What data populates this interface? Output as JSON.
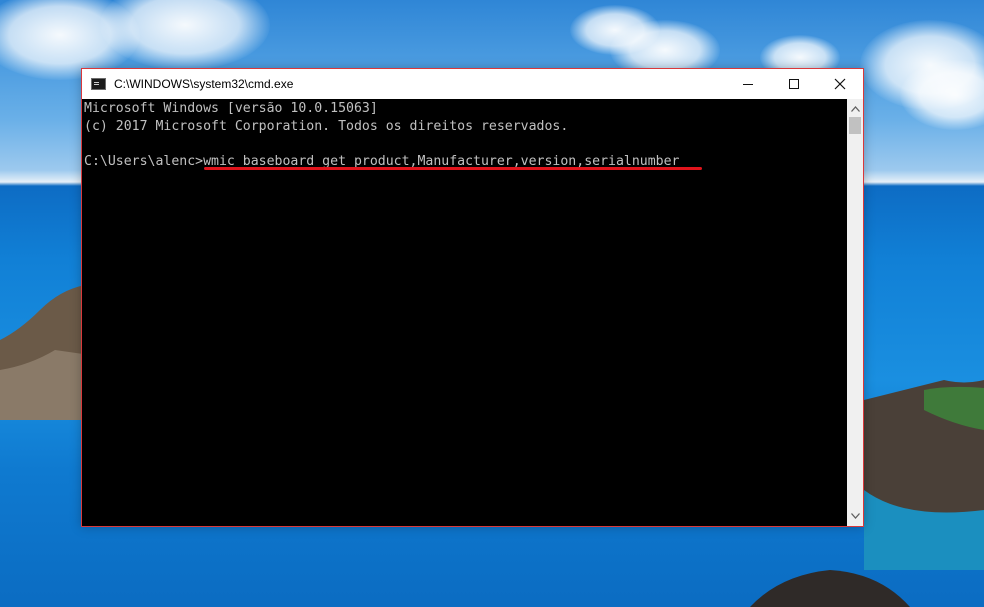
{
  "window": {
    "title": "C:\\WINDOWS\\system32\\cmd.exe",
    "minimize_label": "—",
    "close_label": "✕"
  },
  "console": {
    "lines": [
      "Microsoft Windows [versão 10.0.15063]",
      "(c) 2017 Microsoft Corporation. Todos os direitos reservados.",
      "",
      "C:\\Users\\alenc>wmic baseboard get product,Manufacturer,version,serialnumber"
    ]
  },
  "colors": {
    "console_bg": "#000000",
    "console_text": "#c0c0c0",
    "highlight_underline": "#e0141c",
    "window_border": "#d9383b"
  },
  "icons": [
    "cmd-app-icon",
    "minimize-icon",
    "maximize-icon",
    "close-icon",
    "scroll-up-icon",
    "scroll-down-icon"
  ]
}
